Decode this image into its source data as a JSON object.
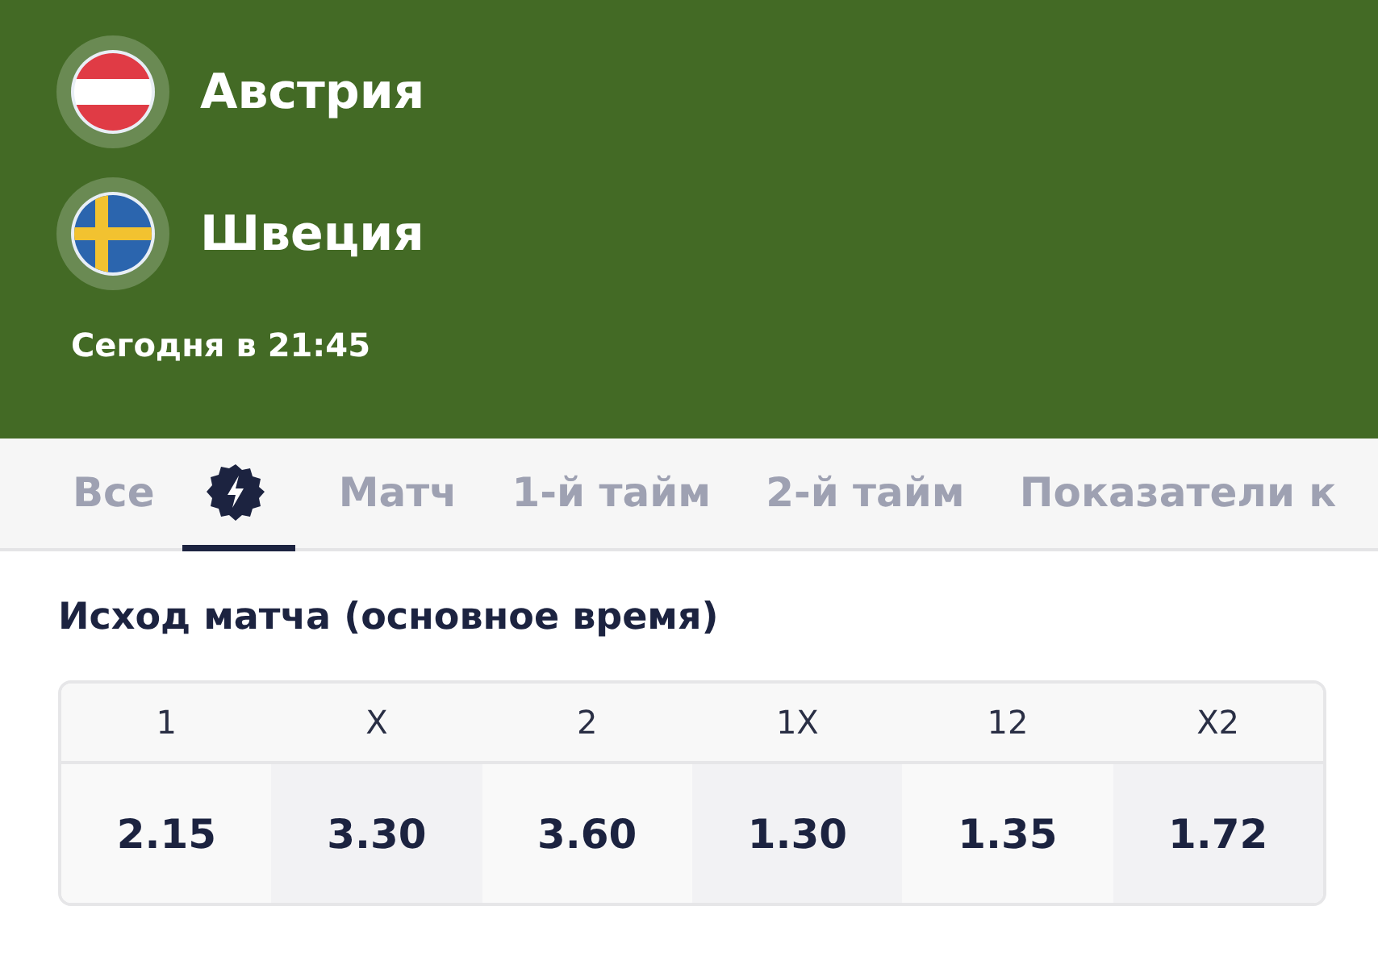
{
  "match": {
    "teams": [
      {
        "name": "Австрия",
        "kind": "austria"
      },
      {
        "name": "Швеция",
        "kind": "sweden"
      }
    ],
    "time": "Сегодня в 21:45"
  },
  "tabs": [
    {
      "kind": "text",
      "label": "Все",
      "selected": false
    },
    {
      "kind": "icon",
      "selected": true
    },
    {
      "kind": "text",
      "label": "Матч",
      "selected": false
    },
    {
      "kind": "text",
      "label": "1-й тайм",
      "selected": false
    },
    {
      "kind": "text",
      "label": "2-й тайм",
      "selected": false
    },
    {
      "kind": "text",
      "label": "Показатели к",
      "selected": false
    }
  ],
  "market": {
    "title": "Исход матча (основное время)",
    "outcomes": [
      {
        "label": "1",
        "odds": "2.15"
      },
      {
        "label": "X",
        "odds": "3.30"
      },
      {
        "label": "2",
        "odds": "3.60"
      },
      {
        "label": "1X",
        "odds": "1.30"
      },
      {
        "label": "12",
        "odds": "1.35"
      },
      {
        "label": "X2",
        "odds": "1.72"
      }
    ]
  }
}
